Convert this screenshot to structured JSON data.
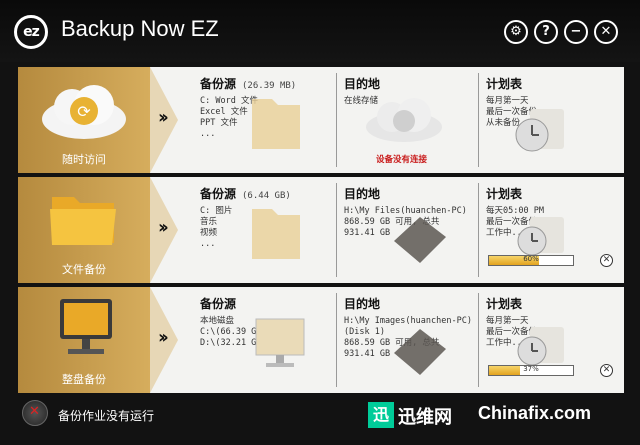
{
  "app": {
    "logo_text": "ez",
    "title": "Backup Now EZ"
  },
  "window_buttons": [
    {
      "name": "settings",
      "glyph": "⚙"
    },
    {
      "name": "help",
      "glyph": "?"
    },
    {
      "name": "minimize",
      "glyph": "−"
    },
    {
      "name": "close",
      "glyph": "✕"
    }
  ],
  "jobs": [
    {
      "label": "随时访问",
      "icon": "cloud-sync-icon",
      "source": {
        "heading": "备份源",
        "size": "(26.39 MB)",
        "lines": [
          "C: Word 文件",
          "   Excel 文件",
          "   PPT 文件",
          "   ..."
        ]
      },
      "destination": {
        "heading": "目的地",
        "lines": [
          "在线存储"
        ],
        "warning": "设备没有连接"
      },
      "schedule": {
        "heading": "计划表",
        "lines": [
          "每月第一天",
          "最后一次备份:",
          "从未备份"
        ]
      }
    },
    {
      "label": "文件备份",
      "icon": "folder-icon",
      "source": {
        "heading": "备份源",
        "size": "(6.44 GB)",
        "lines": [
          "C: 图片",
          "   音乐",
          "   视频",
          "   ..."
        ]
      },
      "destination": {
        "heading": "目的地",
        "lines": [
          "H:\\My Files(huanchen-PC)",
          "868.59 GB 可用, 总共",
          "931.41 GB"
        ]
      },
      "schedule": {
        "heading": "计划表",
        "lines": [
          "每天05:00 PM",
          "最后一次备份:",
          "工作中..."
        ],
        "progress": 0.6,
        "progress_text": "60%"
      }
    },
    {
      "label": "整盘备份",
      "icon": "computer-icon",
      "source": {
        "heading": "备份源",
        "size": "",
        "lines": [
          "本地磁盘",
          "C:\\(66.39 GB)",
          "D:\\(32.21 GB)"
        ]
      },
      "destination": {
        "heading": "目的地",
        "lines": [
          "H:\\My Images(huanchen-PC)",
          "(Disk 1)",
          "868.59 GB 可用, 总共",
          "931.41 GB"
        ]
      },
      "schedule": {
        "heading": "计划表",
        "lines": [
          "每月第一天",
          "最后一次备份:",
          "工作中..."
        ],
        "progress": 0.37,
        "progress_text": "37%"
      }
    }
  ],
  "status": {
    "text": "备份作业没有运行"
  },
  "watermark": {
    "badge": "迅",
    "brand_cn": "迅维网",
    "brand_en": "Chinafix.com"
  }
}
